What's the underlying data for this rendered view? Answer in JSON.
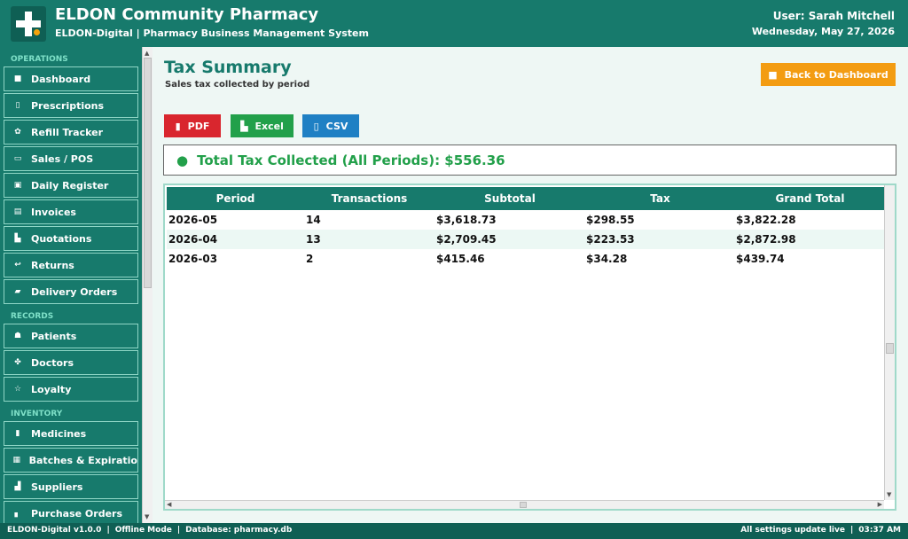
{
  "header": {
    "title": "ELDON Community Pharmacy",
    "subtitle": "ELDON-Digital  |  Pharmacy Business Management System",
    "user": "User: Sarah Mitchell",
    "date": "Wednesday, May 27, 2026"
  },
  "sidebar": {
    "sections": [
      {
        "label": "OPERATIONS",
        "items": [
          {
            "icon": "home-icon",
            "glyph": "■",
            "label": "Dashboard"
          },
          {
            "icon": "prescription-icon",
            "glyph": "▯",
            "label": "Prescriptions"
          },
          {
            "icon": "refill-icon",
            "glyph": "✿",
            "label": "Refill Tracker"
          },
          {
            "icon": "pos-icon",
            "glyph": "▭",
            "label": "Sales / POS"
          },
          {
            "icon": "register-icon",
            "glyph": "▣",
            "label": "Daily Register"
          },
          {
            "icon": "invoice-icon",
            "glyph": "▤",
            "label": "Invoices"
          },
          {
            "icon": "quotation-icon",
            "glyph": "▙",
            "label": "Quotations"
          },
          {
            "icon": "return-icon",
            "glyph": "↩",
            "label": "Returns"
          },
          {
            "icon": "truck-icon",
            "glyph": "▰",
            "label": "Delivery Orders"
          }
        ]
      },
      {
        "label": "RECORDS",
        "items": [
          {
            "icon": "patients-icon",
            "glyph": "☗",
            "label": "Patients"
          },
          {
            "icon": "doctor-icon",
            "glyph": "✤",
            "label": "Doctors"
          },
          {
            "icon": "star-icon",
            "glyph": "☆",
            "label": "Loyalty"
          }
        ]
      },
      {
        "label": "INVENTORY",
        "items": [
          {
            "icon": "medicine-icon",
            "glyph": "▮",
            "label": "Medicines"
          },
          {
            "icon": "batch-icon",
            "glyph": "▦",
            "label": "Batches & Expiratio"
          },
          {
            "icon": "supplier-icon",
            "glyph": "▟",
            "label": "Suppliers"
          },
          {
            "icon": "purchase-icon",
            "glyph": "▖",
            "label": "Purchase Orders"
          }
        ]
      }
    ]
  },
  "main": {
    "title": "Tax Summary",
    "subtitle": "Sales tax collected by period",
    "back_label": "Back to Dashboard",
    "export": {
      "pdf": "PDF",
      "excel": "Excel",
      "csv": "CSV"
    },
    "total_label": "Total Tax Collected (All Periods): $556.36",
    "table": {
      "columns": [
        "Period",
        "Transactions",
        "Subtotal",
        "Tax",
        "Grand Total"
      ],
      "rows": [
        [
          "2026-05",
          "14",
          "$3,618.73",
          "$298.55",
          "$3,822.28"
        ],
        [
          "2026-04",
          "13",
          "$2,709.45",
          "$223.53",
          "$2,872.98"
        ],
        [
          "2026-03",
          "2",
          "$415.46",
          "$34.28",
          "$439.74"
        ]
      ]
    }
  },
  "footer": {
    "version": "ELDON-Digital v1.0.0",
    "mode": "Offline Mode",
    "database": "Database: pharmacy.db",
    "settings": "All settings update live",
    "time": "03:37 AM"
  },
  "colors": {
    "primary": "#177a6c",
    "accent": "#f39c12",
    "pdf": "#d9262e",
    "excel": "#22a04a",
    "csv": "#1f80c4"
  }
}
